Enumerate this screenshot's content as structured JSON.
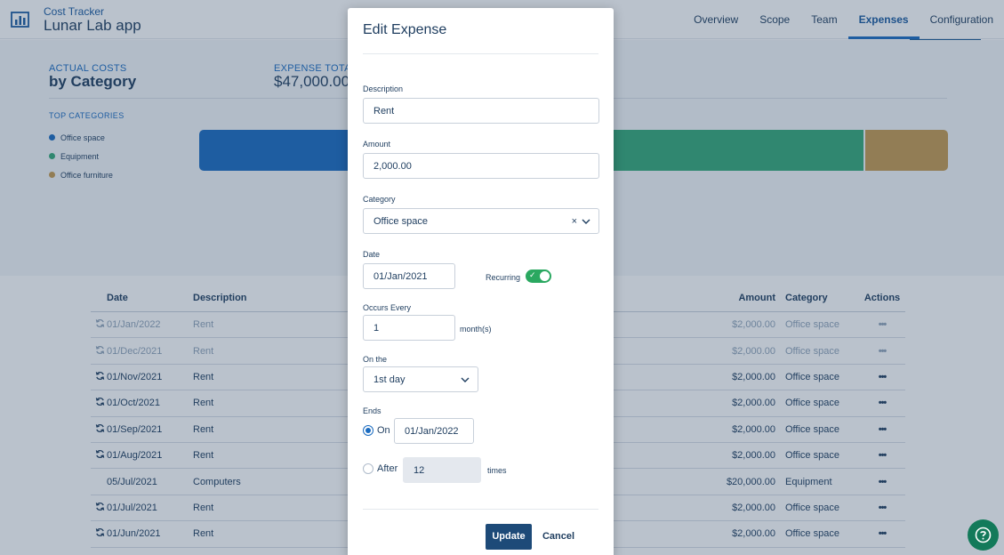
{
  "app": {
    "subtitle": "Cost Tracker",
    "title": "Lunar Lab app"
  },
  "nav": [
    {
      "label": "Overview",
      "active": false
    },
    {
      "label": "Scope",
      "active": false
    },
    {
      "label": "Team",
      "active": false
    },
    {
      "label": "Expenses",
      "active": true
    },
    {
      "label": "Configuration",
      "active": false
    }
  ],
  "summary": {
    "actual_costs_label": "ACTUAL COSTS",
    "by_category_label": "by Category",
    "expense_total_label": "EXPENSE TOTAL",
    "expense_total_value": "$47,000.00",
    "top_categories_label": "TOP CATEGORIES",
    "legend": [
      {
        "name": "Office space",
        "color": "#1a6bc0"
      },
      {
        "name": "Equipment",
        "color": "#34a878"
      },
      {
        "name": "Office furniture",
        "color": "#c49a50"
      }
    ],
    "bar_fractions": [
      0.53,
      0.36,
      0.11
    ]
  },
  "table": {
    "headers": {
      "date": "Date",
      "description": "Description",
      "amount": "Amount",
      "category": "Category",
      "actions": "Actions"
    },
    "rows": [
      {
        "recurring": true,
        "faded": true,
        "date": "01/Jan/2022",
        "description": "Rent",
        "amount": "$2,000.00",
        "category": "Office space",
        "actions": "•••"
      },
      {
        "recurring": true,
        "faded": true,
        "date": "01/Dec/2021",
        "description": "Rent",
        "amount": "$2,000.00",
        "category": "Office space",
        "actions": "•••"
      },
      {
        "recurring": true,
        "faded": false,
        "date": "01/Nov/2021",
        "description": "Rent",
        "amount": "$2,000.00",
        "category": "Office space",
        "actions": "•••"
      },
      {
        "recurring": true,
        "faded": false,
        "date": "01/Oct/2021",
        "description": "Rent",
        "amount": "$2,000.00",
        "category": "Office space",
        "actions": "•••"
      },
      {
        "recurring": true,
        "faded": false,
        "date": "01/Sep/2021",
        "description": "Rent",
        "amount": "$2,000.00",
        "category": "Office space",
        "actions": "•••"
      },
      {
        "recurring": true,
        "faded": false,
        "date": "01/Aug/2021",
        "description": "Rent",
        "amount": "$2,000.00",
        "category": "Office space",
        "actions": "•••"
      },
      {
        "recurring": false,
        "faded": false,
        "date": "05/Jul/2021",
        "description": "Computers",
        "amount": "$20,000.00",
        "category": "Equipment",
        "actions": "•••"
      },
      {
        "recurring": true,
        "faded": false,
        "date": "01/Jul/2021",
        "description": "Rent",
        "amount": "$2,000.00",
        "category": "Office space",
        "actions": "•••"
      },
      {
        "recurring": true,
        "faded": false,
        "date": "01/Jun/2021",
        "description": "Rent",
        "amount": "$2,000.00",
        "category": "Office space",
        "actions": "•••"
      }
    ]
  },
  "modal": {
    "title": "Edit Expense",
    "description_label": "Description",
    "description_value": "Rent",
    "amount_label": "Amount",
    "amount_value": "2,000.00",
    "category_label": "Category",
    "category_value": "Office space",
    "category_clear": "×",
    "date_label": "Date",
    "date_value": "01/Jan/2021",
    "recurring_label": "Recurring",
    "recurring_on": true,
    "toggle_check": "✓",
    "occurs_every_label": "Occurs Every",
    "occurs_every_value": "1",
    "occurs_unit": "month(s)",
    "on_the_label": "On the",
    "on_the_value": "1st day",
    "ends_label": "Ends",
    "ends_on_label": "On",
    "ends_on_value": "01/Jan/2022",
    "ends_after_label": "After",
    "ends_after_value": "12",
    "ends_after_unit": "times",
    "update_label": "Update",
    "cancel_label": "Cancel"
  },
  "colors": {
    "accent": "#1a6bc0",
    "primary_button": "#1d4a78",
    "toggle_on": "#2aa860",
    "help": "#137a5a"
  }
}
